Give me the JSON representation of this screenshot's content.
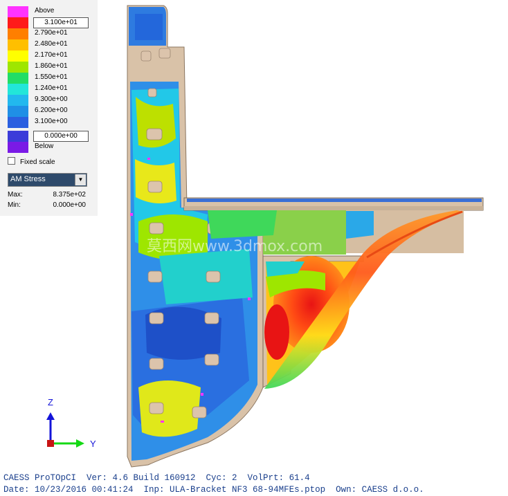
{
  "legend": {
    "above_label": "Above",
    "below_label": "Below",
    "max_box": "3.100e+01",
    "min_box": "0.000e+00",
    "levels": [
      {
        "label": "2.790e+01",
        "color": "#ff7f00"
      },
      {
        "label": "2.480e+01",
        "color": "#ffbf00"
      },
      {
        "label": "2.170e+01",
        "color": "#ffff00"
      },
      {
        "label": "1.860e+01",
        "color": "#9ee600"
      },
      {
        "label": "1.550e+01",
        "color": "#22dd66"
      },
      {
        "label": "1.240e+01",
        "color": "#22e6d9"
      },
      {
        "label": "9.300e+00",
        "color": "#22b8ee"
      },
      {
        "label": "6.200e+00",
        "color": "#1f8fe6"
      },
      {
        "label": "3.100e+00",
        "color": "#2a5fe0"
      }
    ],
    "colors": {
      "above": "#ff33ff",
      "top": "#ff1a1a",
      "bottom": "#3c3cd9",
      "below": "#7a1ae6"
    }
  },
  "controls": {
    "fixed_scale_label": "Fixed scale",
    "result_type": "AM Stress",
    "max_label": "Max:",
    "max_value": "8.375e+02",
    "min_label": "Min:",
    "min_value": "0.000e+00"
  },
  "axes": {
    "z_label": "Z",
    "y_label": "Y"
  },
  "watermark": "莫西网www.3dmox.com",
  "status": {
    "line1": "CAESS ProTOpCI  Ver: 4.6 Build 160912  Cyc: 2  VolPrt: 61.4",
    "line2": "Date: 10/23/2016 00:41:24  Inp: ULA-Bracket NF3 68-94MFEs.ptop  Own: CAESS d.o.o."
  }
}
